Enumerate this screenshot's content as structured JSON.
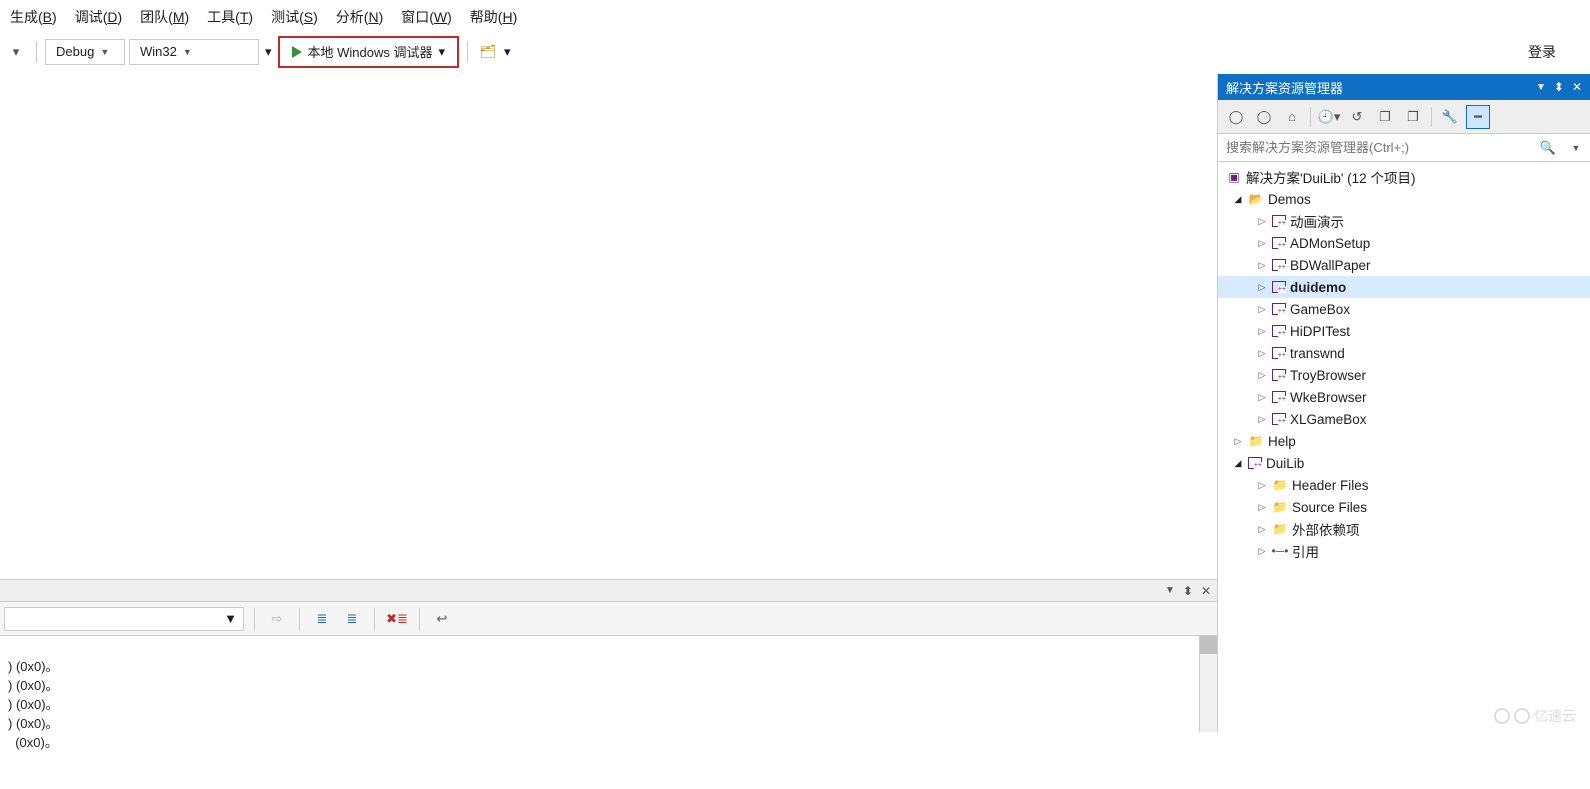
{
  "menu": {
    "build": {
      "label": "生成",
      "key": "B"
    },
    "debug": {
      "label": "调试",
      "key": "D"
    },
    "team": {
      "label": "团队",
      "key": "M"
    },
    "tools": {
      "label": "工具",
      "key": "T"
    },
    "test": {
      "label": "测试",
      "key": "S"
    },
    "analyze": {
      "label": "分析",
      "key": "N"
    },
    "window": {
      "label": "窗口",
      "key": "W"
    },
    "help": {
      "label": "帮助",
      "key": "H"
    }
  },
  "login": "登录",
  "toolbar": {
    "config": "Debug",
    "platform": "Win32",
    "debugger": "本地 Windows 调试器"
  },
  "solution_explorer": {
    "title": "解决方案资源管理器",
    "search_placeholder": "搜索解决方案资源管理器(Ctrl+;)",
    "solution_label": "解决方案'DuiLib' (12 个项目)",
    "folders": {
      "demos": "Demos",
      "help": "Help"
    },
    "projects": [
      "动画演示",
      "ADMonSetup",
      "BDWallPaper",
      "duidemo",
      "GameBox",
      "HiDPITest",
      "transwnd",
      "TroyBrowser",
      "WkeBrowser",
      "XLGameBox"
    ],
    "duilib": {
      "name": "DuiLib",
      "header": "Header Files",
      "source": "Source Files",
      "external": "外部依赖项",
      "refs": "引用"
    }
  },
  "output": {
    "lines": [
      ") (0x0)。",
      ") (0x0)。",
      ") (0x0)。",
      ") (0x0)。",
      "  (0x0)。"
    ]
  },
  "watermark": "亿速云"
}
